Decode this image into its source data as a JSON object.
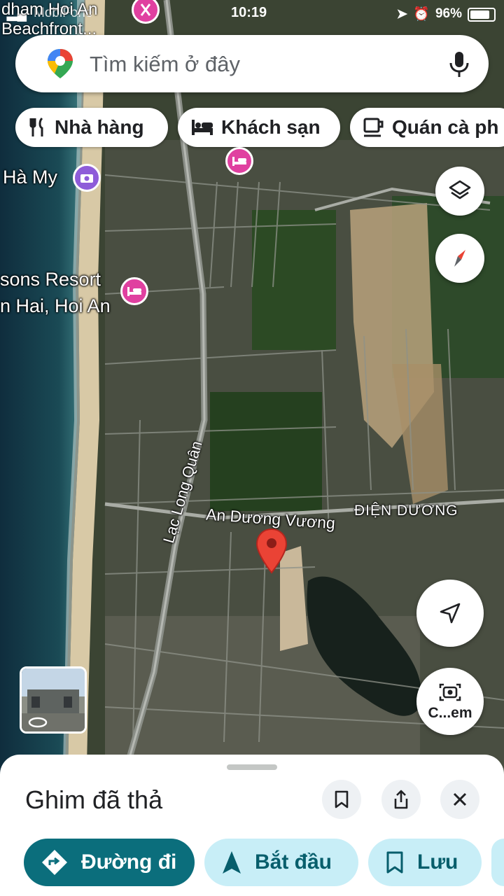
{
  "status_bar": {
    "carrier": "MobiFone",
    "time": "10:19",
    "battery": "96%",
    "battery_level": 0.96
  },
  "map": {
    "top_place_label": "dham Hoi An\nBeachfront...",
    "labels": {
      "ha_my": "Hà My",
      "resort_line1": "sons Resort",
      "resort_line2": "n Hai, Hoi An",
      "street_lac_long_quan": "Lạc Long Quân",
      "street_an_duong_vuong": "An Dương Vương",
      "district": "ĐIỆN DƯƠNG"
    },
    "colors": {
      "pin": "#ea4335",
      "hotel_poi": "#e040a0",
      "photo_poi": "#8e5cd9"
    }
  },
  "search": {
    "placeholder": "Tìm kiếm ở đây",
    "logo_icon": "google-maps-pin-icon",
    "mic_icon": "microphone-icon"
  },
  "chips": [
    {
      "label": "Nhà hàng",
      "icon": "restaurant-icon"
    },
    {
      "label": "Khách sạn",
      "icon": "hotel-bed-icon"
    },
    {
      "label": "Quán cà ph",
      "icon": "coffee-cup-icon"
    }
  ],
  "controls": {
    "layers_icon": "layers-icon",
    "compass_icon": "compass-icon",
    "my_location_icon": "navigation-arrow-icon",
    "camera_label": "C...em"
  },
  "sheet": {
    "title": "Ghim đã thả",
    "buttons": {
      "directions": "Đường đi",
      "start": "Bắt đầu",
      "save": "Lưu"
    },
    "colors": {
      "primary": "#0b6e7c",
      "secondary_bg": "#c8eef7",
      "secondary_text": "#075e6c"
    }
  }
}
